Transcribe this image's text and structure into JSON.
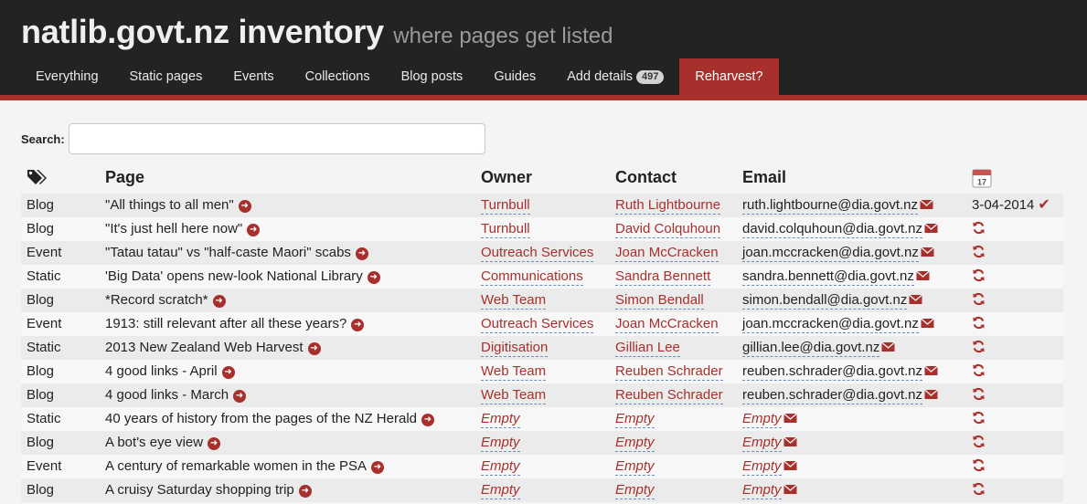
{
  "app": {
    "title": "natlib.govt.nz inventory",
    "subtitle": "where pages get listed"
  },
  "nav": [
    {
      "label": "Everything"
    },
    {
      "label": "Static pages"
    },
    {
      "label": "Events"
    },
    {
      "label": "Collections"
    },
    {
      "label": "Blog posts"
    },
    {
      "label": "Guides"
    },
    {
      "label": "Add details",
      "badge": "497"
    },
    {
      "label": "Reharvest?",
      "active": true
    }
  ],
  "search": {
    "label": "Search:",
    "value": "",
    "placeholder": ""
  },
  "table": {
    "headers": {
      "type_icon": "tags-icon",
      "page": "Page",
      "owner": "Owner",
      "contact": "Contact",
      "email": "Email",
      "status_icon": "calendar-icon",
      "calendar_day": "17"
    },
    "rows": [
      {
        "type": "Blog",
        "page": "\"All things to all men\"",
        "owner": "Turnbull",
        "contact": "Ruth Lightbourne",
        "email": "ruth.lightbourne@dia.govt.nz",
        "status": "3-04-2014",
        "harvested": true
      },
      {
        "type": "Blog",
        "page": "\"It's just hell here now\"",
        "owner": "Turnbull",
        "contact": "David Colquhoun",
        "email": "david.colquhoun@dia.govt.nz"
      },
      {
        "type": "Event",
        "page": "\"Tatau tatau\" vs \"half-caste Maori\" scabs",
        "owner": "Outreach Services",
        "contact": "Joan McCracken",
        "email": "joan.mccracken@dia.govt.nz"
      },
      {
        "type": "Static",
        "page": "'Big Data' opens new-look National Library",
        "owner": "Communications",
        "contact": "Sandra Bennett",
        "email": "sandra.bennett@dia.govt.nz"
      },
      {
        "type": "Blog",
        "page": "*Record scratch*",
        "owner": "Web Team",
        "contact": "Simon Bendall",
        "email": "simon.bendall@dia.govt.nz"
      },
      {
        "type": "Event",
        "page": "1913: still relevant after all these years?",
        "owner": "Outreach Services",
        "contact": "Joan McCracken",
        "email": "joan.mccracken@dia.govt.nz"
      },
      {
        "type": "Static",
        "page": "2013 New Zealand Web Harvest",
        "owner": "Digitisation",
        "contact": "Gillian Lee",
        "email": "gillian.lee@dia.govt.nz"
      },
      {
        "type": "Blog",
        "page": "4 good links - April",
        "owner": "Web Team",
        "contact": "Reuben Schrader",
        "email": "reuben.schrader@dia.govt.nz"
      },
      {
        "type": "Blog",
        "page": "4 good links - March",
        "owner": "Web Team",
        "contact": "Reuben Schrader",
        "email": "reuben.schrader@dia.govt.nz"
      },
      {
        "type": "Static",
        "page": "40 years of history from the pages of the NZ Herald",
        "owner": "Empty",
        "contact": "Empty",
        "email": "Empty",
        "empty": true
      },
      {
        "type": "Blog",
        "page": "A bot's eye view",
        "owner": "Empty",
        "contact": "Empty",
        "email": "Empty",
        "empty": true
      },
      {
        "type": "Event",
        "page": "A century of remarkable women in the PSA",
        "owner": "Empty",
        "contact": "Empty",
        "email": "Empty",
        "empty": true
      },
      {
        "type": "Blog",
        "page": "A cruisy Saturday shopping trip",
        "owner": "Empty",
        "contact": "Empty",
        "email": "Empty",
        "empty": true
      }
    ]
  },
  "colors": {
    "accent": "#a8302c",
    "header_bg": "#232323",
    "badge_bg": "#d2d2d2"
  },
  "icons": {
    "page_link": "arrow-circle-right-icon",
    "email": "envelope-icon",
    "reharvest": "refresh-icon",
    "harvested": "check-icon"
  }
}
